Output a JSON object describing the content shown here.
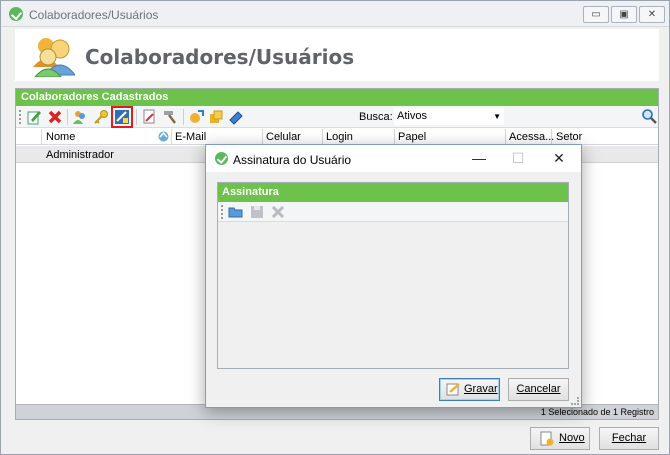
{
  "window": {
    "title": "Colaboradores/Usuários",
    "min_icon": "minimize-icon",
    "max_icon": "maximize-icon",
    "close_icon": "close-icon"
  },
  "header": {
    "title": "Colaboradores/Usuários"
  },
  "panel": {
    "title": "Colaboradores Cadastrados",
    "toolbar": {
      "busca_label": "Busca:",
      "busca_value": "Ativos",
      "icons": [
        "edit-icon",
        "delete-icon",
        "users-icon",
        "key-icon",
        "signature-icon",
        "document-icon",
        "hammer-icon",
        "export-icon",
        "package-icon",
        "eraser-icon",
        "search-icon"
      ]
    },
    "columns": [
      "Nome",
      "E-Mail",
      "Celular",
      "Login",
      "Papel",
      "Acessa...",
      "Setor"
    ],
    "rows": [
      {
        "nome": "Administrador"
      }
    ],
    "status": "1 Selecionado de 1 Registro"
  },
  "footer": {
    "novo_label": "Novo",
    "fechar_label": "Fechar"
  },
  "dialog": {
    "title": "Assinatura do Usuário",
    "section_title": "Assinatura",
    "gravar_label": "Gravar",
    "cancelar_label": "Cancelar"
  },
  "colors": {
    "accent_green": "#6cc24a",
    "highlight_red": "#e21d1d",
    "dialog_border": "#7a9cc5"
  }
}
